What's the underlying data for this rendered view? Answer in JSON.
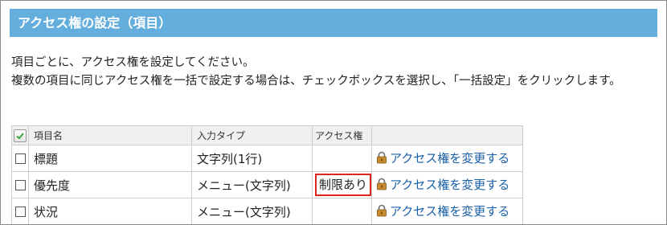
{
  "section": {
    "title": "アクセス権の設定（項目）"
  },
  "description": {
    "line1": "項目ごとに、アクセス権を設定してください。",
    "line2": "複数の項目に同じアクセス権を一括で設定する場合は、チェックボックスを選択し、「一括設定」をクリックします。"
  },
  "table": {
    "headers": {
      "name": "項目名",
      "input_type": "入力タイプ",
      "access": "アクセス権"
    },
    "rows": [
      {
        "name": "標題",
        "input_type": "文字列(1行)",
        "access": "",
        "link": "アクセス権を変更する"
      },
      {
        "name": "優先度",
        "input_type": "メニュー(文字列)",
        "access": "制限あり",
        "link": "アクセス権を変更する"
      },
      {
        "name": "状況",
        "input_type": "メニュー(文字列)",
        "access": "",
        "link": "アクセス権を変更する"
      }
    ]
  },
  "colors": {
    "title_bar": "#63aedc",
    "link": "#1a61a8",
    "highlight_border": "#e0261c"
  },
  "icons": {
    "select_all": "checkmark-icon",
    "link_prefix": "lock-icon"
  }
}
